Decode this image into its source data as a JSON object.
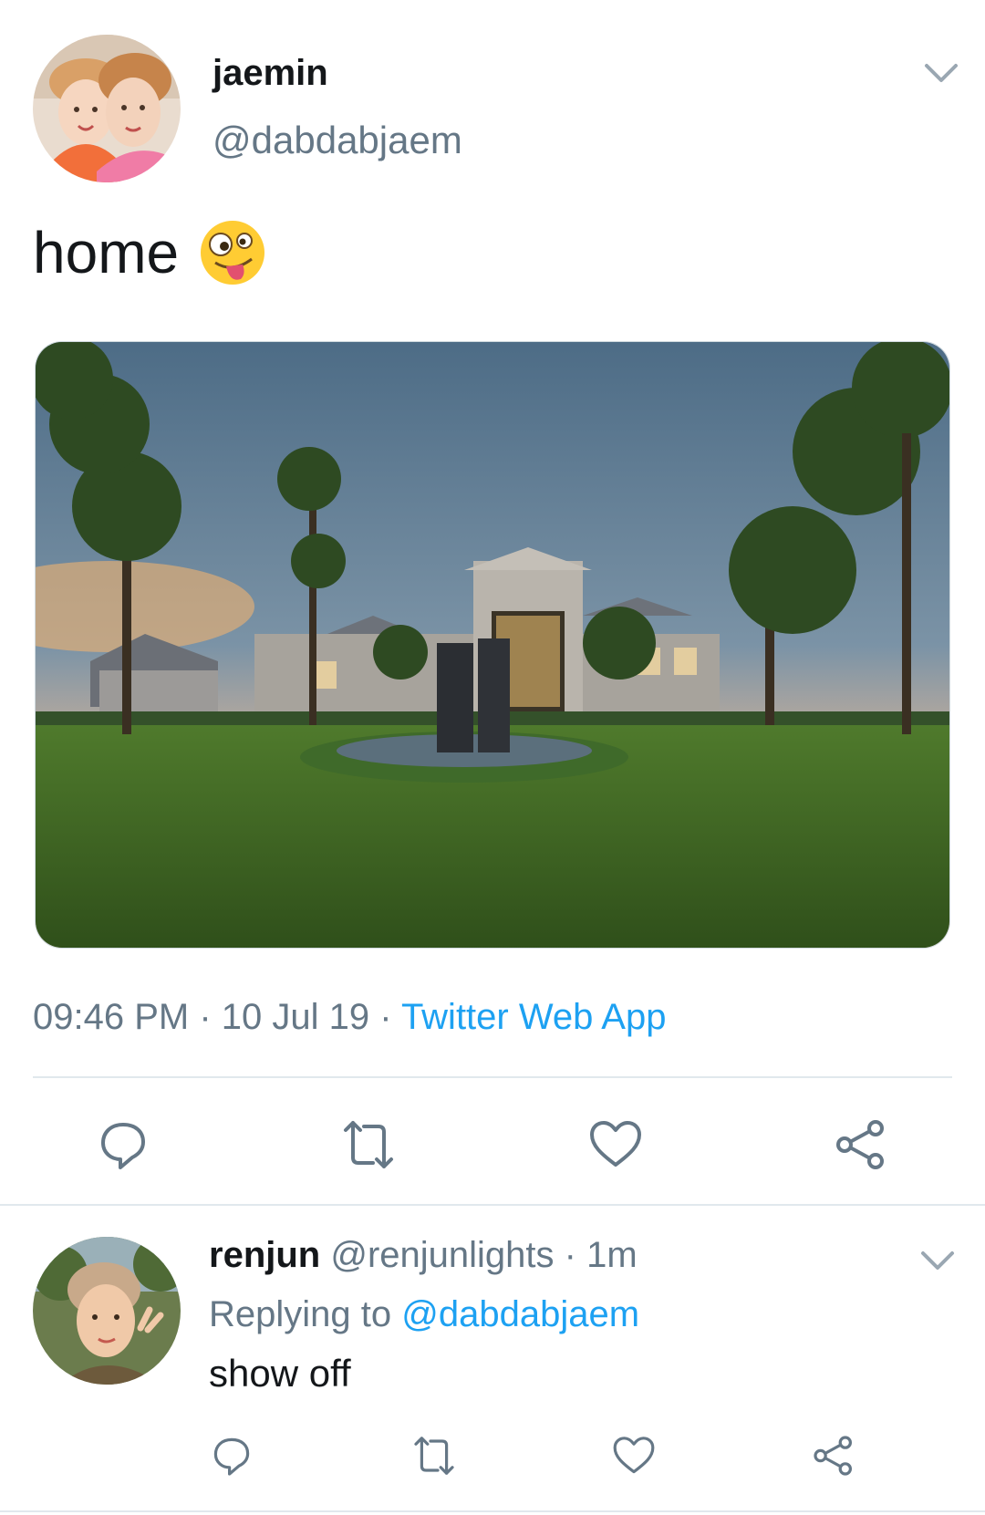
{
  "tweet": {
    "display_name": "jaemin",
    "handle": "@dabdabjaem",
    "text": "home",
    "emoji_icon": "zany-face-emoji",
    "media_description_icon": "mansion-photo",
    "time": "09:46 PM",
    "separator": " · ",
    "date": "10 Jul 19",
    "source": "Twitter Web App",
    "actions": [
      {
        "name": "reply",
        "icon": "comment-icon"
      },
      {
        "name": "retweet",
        "icon": "retweet-icon"
      },
      {
        "name": "like",
        "icon": "heart-icon"
      },
      {
        "name": "share",
        "icon": "share-icon"
      }
    ]
  },
  "reply": {
    "display_name": "renjun",
    "handle": "@renjunlights",
    "separator": " · ",
    "age": "1m",
    "replying_label": "Replying to ",
    "replying_to": "@dabdabjaem",
    "text": "show off"
  },
  "colors": {
    "text": "#14171a",
    "muted": "#657786",
    "accent": "#1da1f2",
    "divider": "#e1e8ed"
  }
}
